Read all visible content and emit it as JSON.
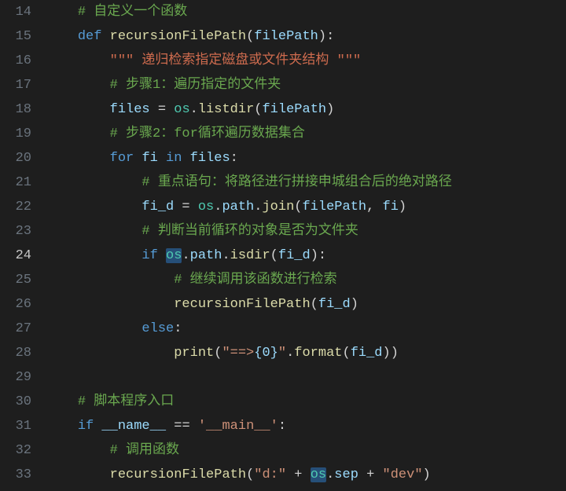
{
  "watermark": "",
  "lines": [
    {
      "num": "14",
      "cur": false,
      "tokens": [
        {
          "t": "    ",
          "c": ""
        },
        {
          "t": "# 自定义一个函数",
          "c": "c-comment"
        }
      ]
    },
    {
      "num": "15",
      "cur": false,
      "tokens": [
        {
          "t": "    ",
          "c": ""
        },
        {
          "t": "def",
          "c": "c-kw"
        },
        {
          "t": " ",
          "c": ""
        },
        {
          "t": "recursionFilePath",
          "c": "c-fn"
        },
        {
          "t": "(",
          "c": "c-punc"
        },
        {
          "t": "filePath",
          "c": "c-var"
        },
        {
          "t": ")",
          "c": "c-punc"
        },
        {
          "t": ":",
          "c": "c-punc"
        }
      ]
    },
    {
      "num": "16",
      "cur": false,
      "tokens": [
        {
          "t": "        ",
          "c": ""
        },
        {
          "t": "\"\"\" 递归检索指定磁盘或文件夹结构 \"\"\"",
          "c": "c-docstr"
        }
      ]
    },
    {
      "num": "17",
      "cur": false,
      "tokens": [
        {
          "t": "        ",
          "c": ""
        },
        {
          "t": "# 步骤1：遍历指定的文件夹",
          "c": "c-comment"
        }
      ]
    },
    {
      "num": "18",
      "cur": false,
      "tokens": [
        {
          "t": "        ",
          "c": ""
        },
        {
          "t": "files",
          "c": "c-var"
        },
        {
          "t": " = ",
          "c": "c-op"
        },
        {
          "t": "os",
          "c": "c-builtin"
        },
        {
          "t": ".",
          "c": "c-punc"
        },
        {
          "t": "listdir",
          "c": "c-fn"
        },
        {
          "t": "(",
          "c": "c-punc"
        },
        {
          "t": "filePath",
          "c": "c-var"
        },
        {
          "t": ")",
          "c": "c-punc"
        }
      ]
    },
    {
      "num": "19",
      "cur": false,
      "tokens": [
        {
          "t": "        ",
          "c": ""
        },
        {
          "t": "# 步骤2：for循环遍历数据集合",
          "c": "c-comment"
        }
      ]
    },
    {
      "num": "20",
      "cur": false,
      "tokens": [
        {
          "t": "        ",
          "c": ""
        },
        {
          "t": "for",
          "c": "c-kw"
        },
        {
          "t": " ",
          "c": ""
        },
        {
          "t": "fi",
          "c": "c-var"
        },
        {
          "t": " ",
          "c": ""
        },
        {
          "t": "in",
          "c": "c-kw"
        },
        {
          "t": " ",
          "c": ""
        },
        {
          "t": "files",
          "c": "c-var"
        },
        {
          "t": ":",
          "c": "c-punc"
        }
      ]
    },
    {
      "num": "21",
      "cur": false,
      "tokens": [
        {
          "t": "            ",
          "c": ""
        },
        {
          "t": "# 重点语句：将路径进行拼接申城组合后的绝对路径",
          "c": "c-comment"
        }
      ]
    },
    {
      "num": "22",
      "cur": false,
      "tokens": [
        {
          "t": "            ",
          "c": ""
        },
        {
          "t": "fi_d",
          "c": "c-var"
        },
        {
          "t": " = ",
          "c": "c-op"
        },
        {
          "t": "os",
          "c": "c-builtin"
        },
        {
          "t": ".",
          "c": "c-punc"
        },
        {
          "t": "path",
          "c": "c-var"
        },
        {
          "t": ".",
          "c": "c-punc"
        },
        {
          "t": "join",
          "c": "c-fn"
        },
        {
          "t": "(",
          "c": "c-punc"
        },
        {
          "t": "filePath",
          "c": "c-var"
        },
        {
          "t": ", ",
          "c": "c-punc"
        },
        {
          "t": "fi",
          "c": "c-var"
        },
        {
          "t": ")",
          "c": "c-punc"
        }
      ]
    },
    {
      "num": "23",
      "cur": false,
      "tokens": [
        {
          "t": "            ",
          "c": ""
        },
        {
          "t": "# 判断当前循环的对象是否为文件夹",
          "c": "c-comment"
        }
      ]
    },
    {
      "num": "24",
      "cur": true,
      "tokens": [
        {
          "t": "            ",
          "c": ""
        },
        {
          "t": "if",
          "c": "c-kw"
        },
        {
          "t": " ",
          "c": ""
        },
        {
          "t": "os",
          "c": "c-builtin c-hl"
        },
        {
          "t": ".",
          "c": "c-punc"
        },
        {
          "t": "path",
          "c": "c-var"
        },
        {
          "t": ".",
          "c": "c-punc"
        },
        {
          "t": "isdir",
          "c": "c-fn"
        },
        {
          "t": "(",
          "c": "c-punc"
        },
        {
          "t": "fi_d",
          "c": "c-var"
        },
        {
          "t": ")",
          "c": "c-punc"
        },
        {
          "t": ":",
          "c": "c-punc"
        }
      ]
    },
    {
      "num": "25",
      "cur": false,
      "tokens": [
        {
          "t": "                ",
          "c": ""
        },
        {
          "t": "# 继续调用该函数进行检索",
          "c": "c-comment"
        }
      ]
    },
    {
      "num": "26",
      "cur": false,
      "tokens": [
        {
          "t": "                ",
          "c": ""
        },
        {
          "t": "recursionFilePath",
          "c": "c-fn"
        },
        {
          "t": "(",
          "c": "c-punc"
        },
        {
          "t": "fi_d",
          "c": "c-var"
        },
        {
          "t": ")",
          "c": "c-punc"
        }
      ]
    },
    {
      "num": "27",
      "cur": false,
      "tokens": [
        {
          "t": "            ",
          "c": ""
        },
        {
          "t": "else",
          "c": "c-kw"
        },
        {
          "t": ":",
          "c": "c-punc"
        }
      ]
    },
    {
      "num": "28",
      "cur": false,
      "tokens": [
        {
          "t": "                ",
          "c": ""
        },
        {
          "t": "print",
          "c": "c-fn"
        },
        {
          "t": "(",
          "c": "c-punc"
        },
        {
          "t": "\"==>",
          "c": "c-str"
        },
        {
          "t": "{0}",
          "c": "c-var"
        },
        {
          "t": "\"",
          "c": "c-str"
        },
        {
          "t": ".",
          "c": "c-punc"
        },
        {
          "t": "format",
          "c": "c-fn"
        },
        {
          "t": "(",
          "c": "c-punc"
        },
        {
          "t": "fi_d",
          "c": "c-var"
        },
        {
          "t": "))",
          "c": "c-punc"
        }
      ]
    },
    {
      "num": "29",
      "cur": false,
      "tokens": []
    },
    {
      "num": "30",
      "cur": false,
      "tokens": [
        {
          "t": "    ",
          "c": ""
        },
        {
          "t": "# 脚本程序入口",
          "c": "c-comment"
        }
      ]
    },
    {
      "num": "31",
      "cur": false,
      "tokens": [
        {
          "t": "    ",
          "c": ""
        },
        {
          "t": "if",
          "c": "c-kw"
        },
        {
          "t": " ",
          "c": ""
        },
        {
          "t": "__name__",
          "c": "c-var"
        },
        {
          "t": " == ",
          "c": "c-op"
        },
        {
          "t": "'__main__'",
          "c": "c-str"
        },
        {
          "t": ":",
          "c": "c-punc"
        }
      ]
    },
    {
      "num": "32",
      "cur": false,
      "tokens": [
        {
          "t": "        ",
          "c": ""
        },
        {
          "t": "# 调用函数",
          "c": "c-comment"
        }
      ]
    },
    {
      "num": "33",
      "cur": false,
      "tokens": [
        {
          "t": "        ",
          "c": ""
        },
        {
          "t": "recursionFilePath",
          "c": "c-fn"
        },
        {
          "t": "(",
          "c": "c-punc"
        },
        {
          "t": "\"d:\"",
          "c": "c-str"
        },
        {
          "t": " + ",
          "c": "c-op"
        },
        {
          "t": "os",
          "c": "c-builtin c-hl"
        },
        {
          "t": ".",
          "c": "c-punc"
        },
        {
          "t": "sep",
          "c": "c-var"
        },
        {
          "t": " + ",
          "c": "c-op"
        },
        {
          "t": "\"dev\"",
          "c": "c-str"
        },
        {
          "t": ")",
          "c": "c-punc"
        }
      ]
    }
  ]
}
